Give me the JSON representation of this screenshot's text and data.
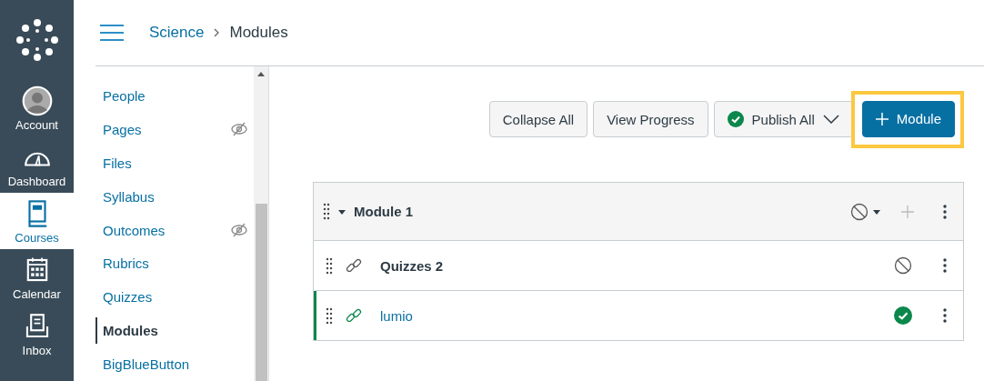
{
  "global_nav": [
    {
      "kind": "account",
      "label": "Account",
      "selected": false
    },
    {
      "kind": "dashboard",
      "label": "Dashboard",
      "selected": false
    },
    {
      "kind": "courses",
      "label": "Courses",
      "selected": true
    },
    {
      "kind": "calendar",
      "label": "Calendar",
      "selected": false
    },
    {
      "kind": "inbox",
      "label": "Inbox",
      "selected": false
    }
  ],
  "breadcrumbs": [
    {
      "label": "Science",
      "link": true
    },
    {
      "label": "Modules",
      "link": false
    }
  ],
  "course_nav": [
    {
      "label": "People",
      "hidden": false,
      "selected": false
    },
    {
      "label": "Pages",
      "hidden": true,
      "selected": false
    },
    {
      "label": "Files",
      "hidden": false,
      "selected": false
    },
    {
      "label": "Syllabus",
      "hidden": false,
      "selected": false
    },
    {
      "label": "Outcomes",
      "hidden": true,
      "selected": false
    },
    {
      "label": "Rubrics",
      "hidden": false,
      "selected": false
    },
    {
      "label": "Quizzes",
      "hidden": false,
      "selected": false
    },
    {
      "label": "Modules",
      "hidden": false,
      "selected": true
    },
    {
      "label": "BigBlueButton",
      "hidden": false,
      "selected": false
    }
  ],
  "toolbar": [
    {
      "kind": "plain",
      "label": "Collapse All"
    },
    {
      "kind": "plain",
      "label": "View Progress"
    },
    {
      "kind": "publish",
      "label": "Publish All"
    },
    {
      "kind": "primary",
      "label": "Module",
      "focused": true
    }
  ],
  "module": {
    "title": "Module 1",
    "expanded": true,
    "published": false,
    "items": [
      {
        "title": "Quizzes 2",
        "published": false
      },
      {
        "title": "lumio",
        "published": true
      }
    ]
  }
}
